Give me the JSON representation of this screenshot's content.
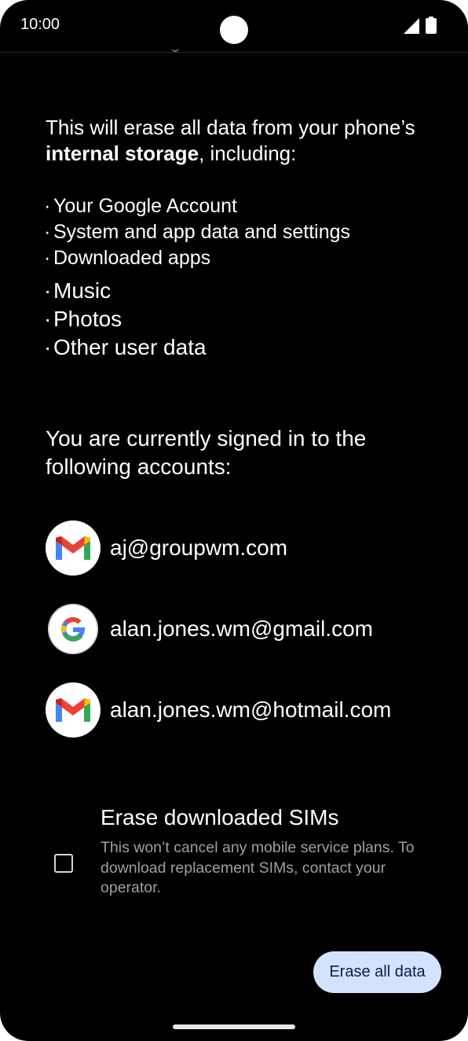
{
  "status_bar": {
    "time": "10:00",
    "icons": [
      "signal-icon",
      "battery-icon"
    ]
  },
  "intro": {
    "prefix": "This will erase all data from your phone’s ",
    "bold": "internal storage",
    "suffix": ", including:"
  },
  "data_items": [
    "Your Google Account",
    "System and app data and settings",
    "Downloaded apps",
    "Music",
    "Photos",
    "Other user data"
  ],
  "accounts_heading": "You are currently signed in to the following accounts:",
  "accounts": [
    {
      "email": "aj@groupwm.com",
      "icon": "gmail-icon"
    },
    {
      "email": "alan.jones.wm@gmail.com",
      "icon": "google-icon"
    },
    {
      "email": "alan.jones.wm@hotmail.com",
      "icon": "gmail-icon"
    }
  ],
  "sim_option": {
    "title": "Erase downloaded SIMs",
    "description": "This won’t cancel any mobile service plans. To download replacement SIMs, contact your operator.",
    "checked": false
  },
  "erase_button": "Erase all data",
  "colors": {
    "background": "#000000",
    "button_bg": "#d3e3fd",
    "button_text": "#041e49",
    "secondary_text": "#9aa0a6"
  }
}
